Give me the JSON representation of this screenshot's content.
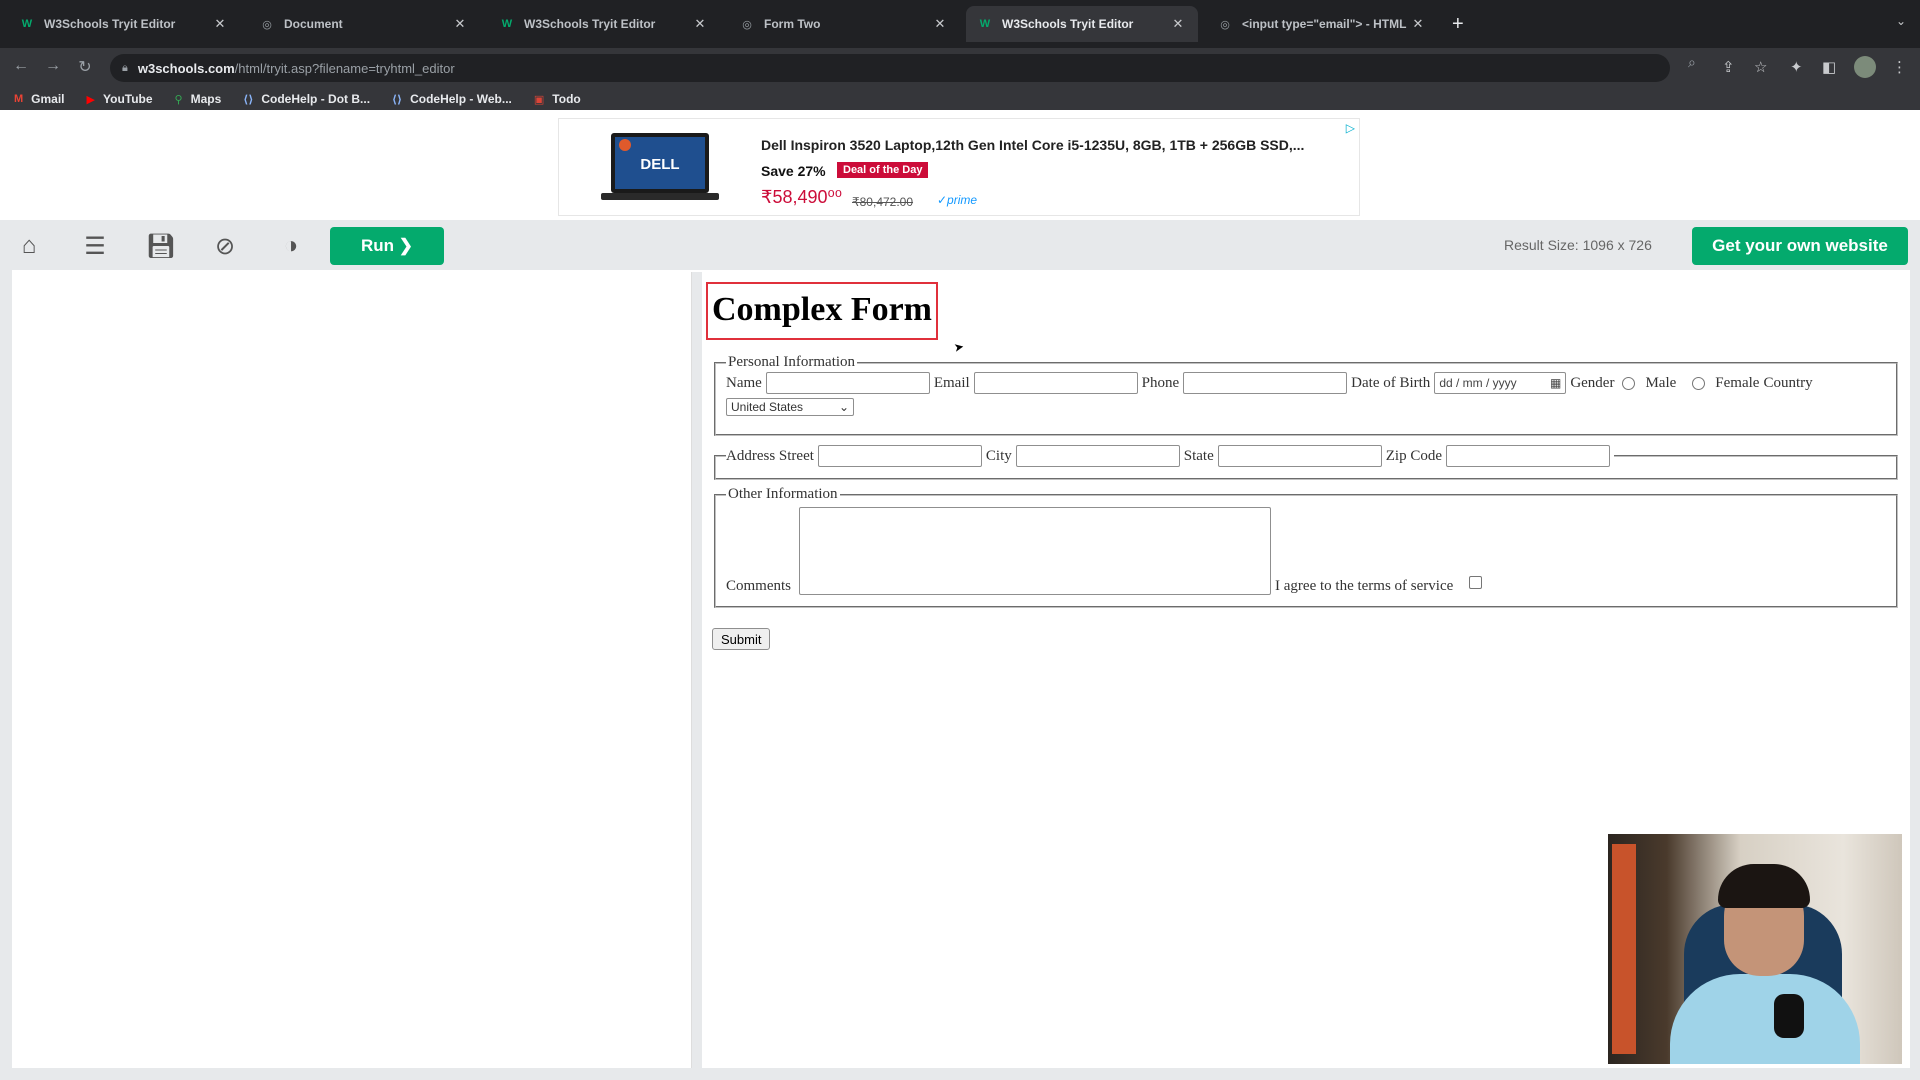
{
  "browser": {
    "tabs": [
      {
        "title": "W3Schools Tryit Editor",
        "icon": "w3schools-favicon",
        "active": false
      },
      {
        "title": "Document",
        "icon": "globe-favicon",
        "active": false
      },
      {
        "title": "W3Schools Tryit Editor",
        "icon": "w3schools-favicon",
        "active": false
      },
      {
        "title": "Form Two",
        "icon": "globe-favicon",
        "active": false
      },
      {
        "title": "W3Schools Tryit Editor",
        "icon": "w3schools-favicon",
        "active": true
      },
      {
        "title": "<input type=\"email\"> - HTML",
        "icon": "globe-favicon",
        "active": false
      }
    ],
    "url_host": "w3schools.com",
    "url_path": "/html/tryit.asp?filename=tryhtml_editor",
    "bookmarks": [
      {
        "label": "Gmail",
        "icon": "gmail-icon"
      },
      {
        "label": "YouTube",
        "icon": "youtube-icon"
      },
      {
        "label": "Maps",
        "icon": "maps-icon"
      },
      {
        "label": "CodeHelp - Dot B...",
        "icon": "codehelp-icon"
      },
      {
        "label": "CodeHelp - Web...",
        "icon": "codehelp-icon"
      },
      {
        "label": "Todo",
        "icon": "todo-icon"
      }
    ]
  },
  "ad": {
    "title": "Dell Inspiron 3520 Laptop,12th Gen Intel Core i5-1235U, 8GB, 1TB + 256GB SSD,...",
    "save": "Save 27%",
    "badge": "Deal of the Day",
    "price": "₹58,490⁰⁰",
    "old_price": "₹80,472.00",
    "prime": "✓prime",
    "brand": "DELL"
  },
  "editor": {
    "run_label": "Run ❯",
    "result_size": "Result Size: 1096 x 726",
    "get_website_label": "Get your own website"
  },
  "form": {
    "heading": "Complex Form",
    "personal": {
      "legend": "Personal Information",
      "name_label": "Name",
      "email_label": "Email",
      "phone_label": "Phone",
      "dob_label": "Date of Birth",
      "dob_placeholder": "dd / mm / yyyy",
      "gender_label": "Gender",
      "male_label": "Male",
      "female_label": "Female",
      "country_label": "Country",
      "country_value": "United States"
    },
    "address": {
      "street_label": "Address Street",
      "city_label": "City",
      "state_label": "State",
      "zip_label": "Zip Code"
    },
    "other": {
      "legend": "Other Information",
      "comments_label": "Comments",
      "terms_label": "I agree to the terms of service"
    },
    "submit_label": "Submit"
  },
  "colors": {
    "w3_green": "#04aa6d",
    "heading_outline": "#e0303b",
    "ad_red": "#cc0c39"
  }
}
